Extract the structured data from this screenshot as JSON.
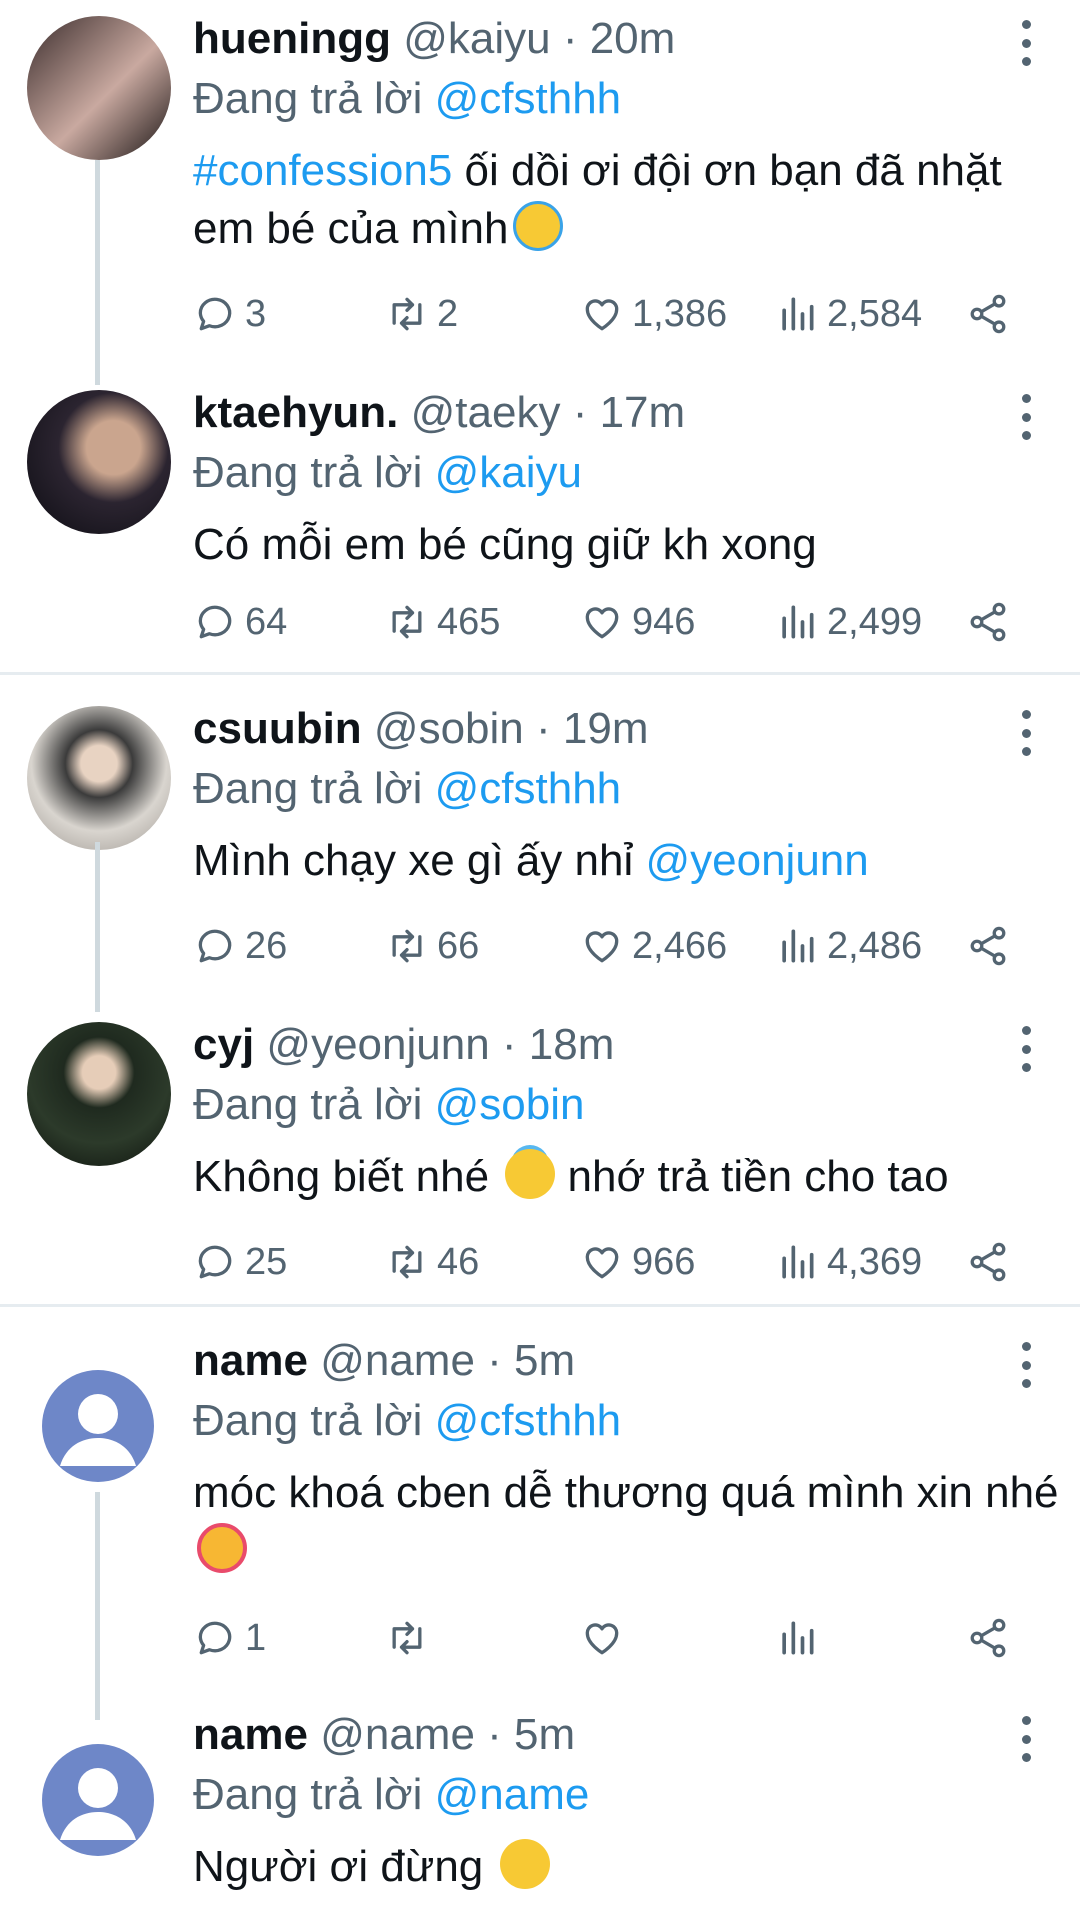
{
  "tweets": [
    {
      "name": "hueningg",
      "handle": "@kaiyu",
      "time": "· 20m",
      "reply_label": "Đang trả lời",
      "reply_to": "@cfsthhh",
      "hashtag": "#confession5",
      "text": " ối dồi ơi đội ơn bạn đã nhặt em bé của mình",
      "replies": "3",
      "retweets": "2",
      "likes": "1,386",
      "views": "2,584"
    },
    {
      "name": "ktaehyun.",
      "handle": "@taeky",
      "time": "· 17m",
      "reply_label": "Đang trả lời",
      "reply_to": "@kaiyu",
      "text": "Có mỗi em bé cũng giữ kh xong",
      "replies": "64",
      "retweets": "465",
      "likes": "946",
      "views": "2,499"
    },
    {
      "name": "csuubin",
      "handle": "@sobin",
      "time": "· 19m",
      "reply_label": "Đang trả lời",
      "reply_to": "@cfsthhh",
      "text": "Mình chạy xe gì ấy nhỉ ",
      "mention": "@yeonjunn",
      "replies": "26",
      "retweets": "66",
      "likes": "2,466",
      "views": "2,486"
    },
    {
      "name": "cyj",
      "handle": "@yeonjunn",
      "time": "· 18m",
      "reply_label": "Đang trả lời",
      "reply_to": "@sobin",
      "text": "Không biết nhé",
      "text2": " nhớ trả tiền cho tao",
      "replies": "25",
      "retweets": "46",
      "likes": "966",
      "views": "4,369"
    },
    {
      "name": "name",
      "handle": "@name",
      "time": "· 5m",
      "reply_label": "Đang trả lời",
      "reply_to": "@cfsthhh",
      "text": "móc khoá cben dễ thương quá mình xin nhé",
      "replies": "1"
    },
    {
      "name": "name",
      "handle": "@name",
      "time": "· 5m",
      "reply_label": "Đang trả lời",
      "reply_to": "@name",
      "text": "Người ơi đừng"
    }
  ],
  "icons": {
    "reply": "reply-icon",
    "retweet": "retweet-icon",
    "like": "heart-icon",
    "views": "views-icon",
    "share": "share-icon",
    "more": "more-icon"
  },
  "colors": {
    "link": "#1d9bf0",
    "secondary": "#536471",
    "separator": "#e6ecf0"
  }
}
